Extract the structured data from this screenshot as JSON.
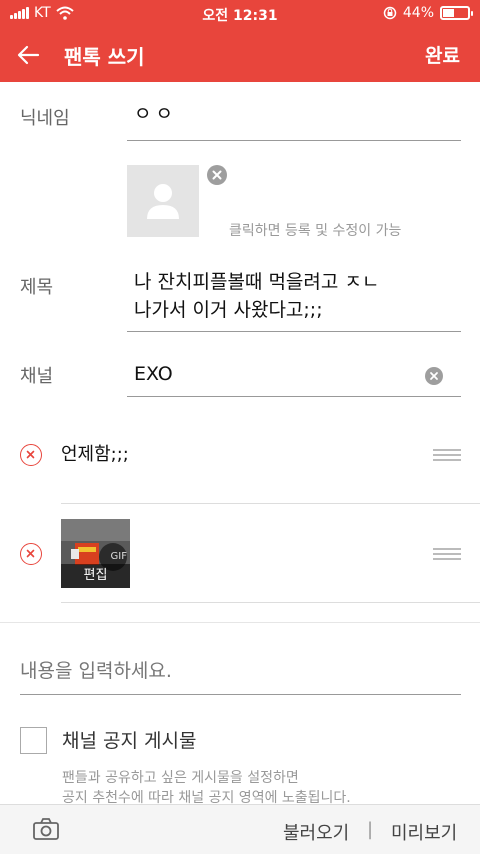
{
  "status_bar": {
    "carrier": "KT",
    "time": "오전 12:31",
    "battery": "44%",
    "battery_level": 0.44
  },
  "header": {
    "title": "팬톡 쓰기",
    "done_label": "완료"
  },
  "form": {
    "nickname_label": "닉네임",
    "nickname_value": "ㅇㅇ",
    "thumbnail_hint": "클릭하면 등록 및 수정이 가능",
    "subject_label": "제목",
    "subject_line1": "나 잔치피플볼때 먹을려고 ㅈㄴ",
    "subject_line2": "나가서 이거 사왔다고;;;",
    "channel_label": "채널",
    "channel_value": "EXO"
  },
  "blocks": [
    {
      "type": "text",
      "text": "언제함;;;"
    },
    {
      "type": "image",
      "edit_label": "편집",
      "badge": "GIF"
    }
  ],
  "content_input": {
    "placeholder": "내용을 입력하세요."
  },
  "notice": {
    "label": "채널 공지 게시물",
    "desc_line1": "팬들과 공유하고 싶은 게시물을 설정하면",
    "desc_line2": "공지 추천수에 따라 채널 공지 영역에 노출됩니다."
  },
  "bottom_bar": {
    "load_label": "불러오기",
    "separator": "|",
    "preview_label": "미리보기"
  },
  "colors": {
    "accent": "#e8453c",
    "remove": "#e8453c",
    "muted_text": "#999999"
  },
  "icons": [
    "signal-icon",
    "wifi-icon",
    "lock-rotation-icon",
    "battery-icon",
    "back-arrow-icon",
    "avatar-placeholder-icon",
    "clear-icon",
    "remove-icon",
    "drag-handle-icon",
    "camera-icon",
    "checkbox-icon"
  ]
}
